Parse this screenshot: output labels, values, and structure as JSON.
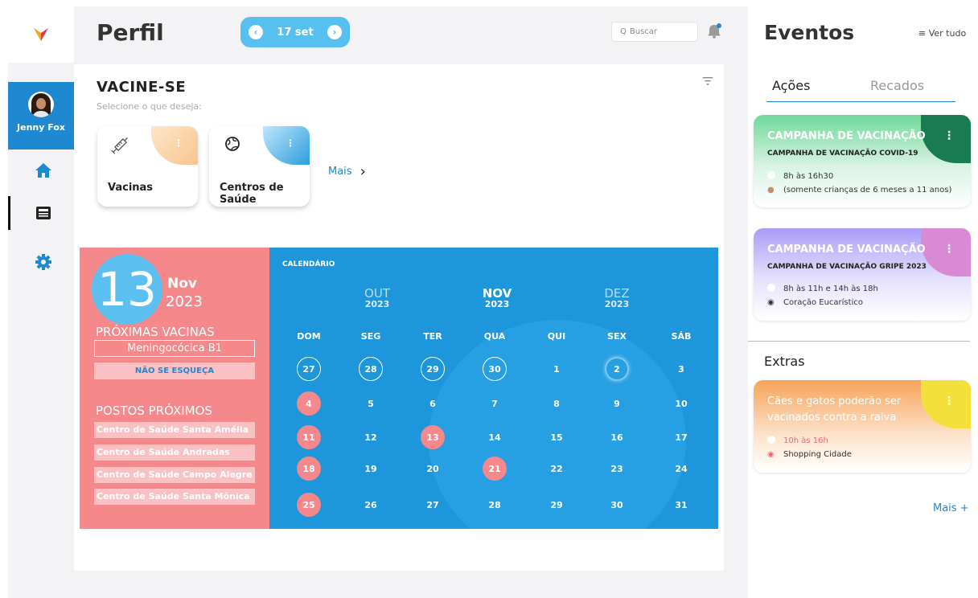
{
  "colors": {
    "accent_blue": "#1e88d0",
    "pill_blue": "#58c0f0",
    "calendar_blue": "#1e96dc",
    "coral": "#f5888a",
    "logo_red": "#e8354a"
  },
  "sidebar": {
    "profile_name": "Jenny Fox",
    "nav": [
      {
        "icon": "home-icon"
      },
      {
        "icon": "newspaper-icon",
        "active": true
      },
      {
        "icon": "gear-icon"
      }
    ]
  },
  "header": {
    "title": "Perfil",
    "date": "17 set",
    "search_placeholder": "Buscar",
    "search_glyph": "Q"
  },
  "vaccinate": {
    "title": "VACINE-SE",
    "subtitle": "Selecione o que deseja:",
    "options": [
      {
        "label": "Vacinas",
        "icon": "syringe-icon"
      },
      {
        "label": "Centros de Saúde",
        "icon": "globe-icon"
      }
    ],
    "more_label": "Mais"
  },
  "today": {
    "day": "13",
    "month": "Nov",
    "year": "2023",
    "next_vaccines_heading": "PRÓXIMAS VACINAS",
    "next_vaccine": "Meningocócica B1",
    "reminder": "NÃO SE ESQUEÇA",
    "nearby_heading": "POSTOS PRÓXIMOS",
    "nearby": [
      "Centro de Saúde Santa Amélia",
      "Centro de Saúde Andradas",
      "Centro de Saúde Campo Alegre",
      "Centro de Saúde Santa Mônica"
    ]
  },
  "calendar": {
    "label": "CALENDÁRIO",
    "months": [
      {
        "name": "OUT",
        "year": "2023"
      },
      {
        "name": "NOV",
        "year": "2023"
      },
      {
        "name": "DEZ",
        "year": "2023"
      }
    ],
    "weekdays": [
      "DOM",
      "SEG",
      "TER",
      "QUA",
      "QUI",
      "SEX",
      "SÁB"
    ],
    "weeks": [
      [
        "27",
        "28",
        "29",
        "30",
        "1",
        "2",
        "3"
      ],
      [
        "4",
        "5",
        "6",
        "7",
        "8",
        "9",
        "10"
      ],
      [
        "11",
        "12",
        "13",
        "14",
        "15",
        "16",
        "17"
      ],
      [
        "18",
        "19",
        "20",
        "21",
        "22",
        "23",
        "24"
      ],
      [
        "25",
        "26",
        "27",
        "28",
        "29",
        "30",
        "31"
      ]
    ],
    "previous_month_days": [
      "27",
      "28",
      "29",
      "30"
    ],
    "highlighted_days": [
      "4",
      "11",
      "13",
      "18",
      "21",
      "25"
    ],
    "ringed_day": "2"
  },
  "events": {
    "title": "Eventos",
    "see_all": "Ver tudo",
    "tabs": [
      "Ações",
      "Recados"
    ],
    "actions": [
      {
        "title": "CAMPANHA DE VACINAÇÃO",
        "subtitle": "CAMPANHA DE VACINAÇÃO COVID-19",
        "time": "8h às 16h30",
        "detail": "(somente crianças de 6 meses a 11 anos)",
        "detail_icon": "child-icon"
      },
      {
        "title": "CAMPANHA DE VACINAÇÃO",
        "subtitle": "CAMPANHA DE VACINAÇÃO GRIPE 2023",
        "time": "8h às 11h e 14h às 18h",
        "detail": "Coração Eucarístico",
        "detail_icon": "location-pin-icon"
      }
    ],
    "extras_heading": "Extras",
    "extras": [
      {
        "title_line1": "Cães e gatos poderão ser",
        "title_line2": "vacinados contra a raiva",
        "time": "10h às 16h",
        "detail": "Shopping Cidade",
        "detail_icon": "location-pin-icon"
      }
    ],
    "more_label": "Mais +"
  }
}
